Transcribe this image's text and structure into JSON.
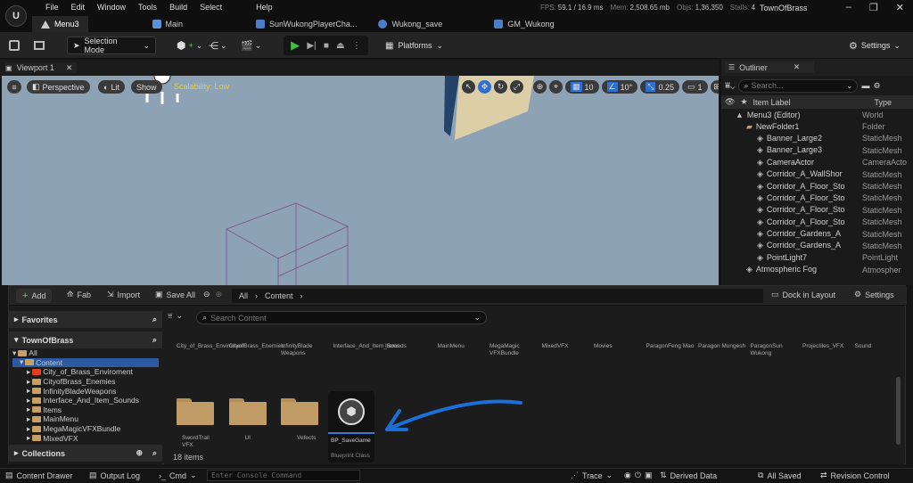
{
  "menu": [
    "File",
    "Edit",
    "Window",
    "Tools",
    "Build",
    "Select",
    "Help"
  ],
  "stats": {
    "fps_label": "FPS:",
    "fps": "59.1",
    "ms": "/ 16.9 ms",
    "mem_label": "Mem:",
    "mem": "2,508.65 mb",
    "objs_label": "Objs:",
    "objs": "1,36,350",
    "stalls_label": "Stalls:",
    "stalls": "4"
  },
  "project": "TownOfBrass",
  "tabs": [
    "Menu3",
    "Main",
    "SunWukongPlayerCha...",
    "Wukong_save",
    "GM_Wukong"
  ],
  "toolbar": {
    "selection_mode": "Selection Mode",
    "platforms": "Platforms",
    "settings": "Settings"
  },
  "viewport": {
    "tab": "Viewport 1",
    "perspective": "Perspective",
    "lit": "Lit",
    "show": "Show",
    "scalability": "Scalability: Low",
    "grid_snap": "10",
    "rot_snap": "10°",
    "scale_snap": "0.25",
    "cam": "1"
  },
  "outliner": {
    "title": "Outliner",
    "search_placeholder": "Search...",
    "col_label": "Item Label",
    "col_type": "Type",
    "rows": [
      {
        "name": "Menu3 (Editor)",
        "type": "World",
        "indent": 1
      },
      {
        "name": "NewFolder1",
        "type": "Folder",
        "indent": 2
      },
      {
        "name": "Banner_Large2",
        "type": "StaticMesh",
        "indent": 3
      },
      {
        "name": "Banner_Large3",
        "type": "StaticMesh",
        "indent": 3
      },
      {
        "name": "CameraActor",
        "type": "CameraActo",
        "indent": 3
      },
      {
        "name": "Corridor_A_WallShor",
        "type": "StaticMesh",
        "indent": 3
      },
      {
        "name": "Corridor_A_Floor_Sto",
        "type": "StaticMesh",
        "indent": 3
      },
      {
        "name": "Corridor_A_Floor_Sto",
        "type": "StaticMesh",
        "indent": 3
      },
      {
        "name": "Corridor_A_Floor_Sto",
        "type": "StaticMesh",
        "indent": 3
      },
      {
        "name": "Corridor_A_Floor_Sto",
        "type": "StaticMesh",
        "indent": 3
      },
      {
        "name": "Corridor_Gardens_A",
        "type": "StaticMesh",
        "indent": 3
      },
      {
        "name": "Corridor_Gardens_A",
        "type": "StaticMesh",
        "indent": 3
      },
      {
        "name": "PointLight7",
        "type": "PointLight",
        "indent": 3
      },
      {
        "name": "Atmospheric Fog",
        "type": "Atmospher",
        "indent": 2
      }
    ]
  },
  "drawer": {
    "add": "Add",
    "fab": "Fab",
    "import": "Import",
    "save_all": "Save All",
    "crumb_all": "All",
    "crumb_content": "Content",
    "dock": "Dock in Layout",
    "settings": "Settings",
    "search_placeholder": "Search Content",
    "favorites": "Favorites",
    "project": "TownOfBrass",
    "collections": "Collections",
    "tree": [
      {
        "label": "All",
        "level": 0
      },
      {
        "label": "Content",
        "level": 1,
        "selected": true
      },
      {
        "label": "City_of_Brass_Enviroment",
        "level": 2,
        "red": true
      },
      {
        "label": "CityofBrass_Enemies",
        "level": 2
      },
      {
        "label": "InfinityBladeWeapons",
        "level": 2
      },
      {
        "label": "Interface_And_Item_Sounds",
        "level": 2
      },
      {
        "label": "Items",
        "level": 2
      },
      {
        "label": "MainMenu",
        "level": 2
      },
      {
        "label": "MegaMagicVFXBundle",
        "level": 2
      },
      {
        "label": "MixedVFX",
        "level": 2
      }
    ],
    "categories": [
      "City_of_Brass_Enviroment",
      "CityofBrass_Enemies",
      "InfinityBlade Weapons",
      "Interface_And_Item_Sounds",
      "Items",
      "MainMenu",
      "MegaMagic VFXBundle",
      "MixedVFX",
      "Movies",
      "ParagonFeng Mao",
      "Paragon Mongesh",
      "ParagonSun Wukong",
      "Projectiles_VFX",
      "Sound"
    ],
    "assets": [
      {
        "name": "SwordTrail VFX"
      },
      {
        "name": "UI"
      },
      {
        "name": "Vefects"
      }
    ],
    "blueprint": {
      "name": "BP_SaveGame",
      "class": "Blueprint Class"
    },
    "count": "18 items"
  },
  "status": {
    "content_drawer": "Content Drawer",
    "output_log": "Output Log",
    "cmd": "Cmd",
    "console_placeholder": "Enter Console Command",
    "trace": "Trace",
    "derived": "Derived Data",
    "saved": "All Saved",
    "revision": "Revision Control"
  }
}
